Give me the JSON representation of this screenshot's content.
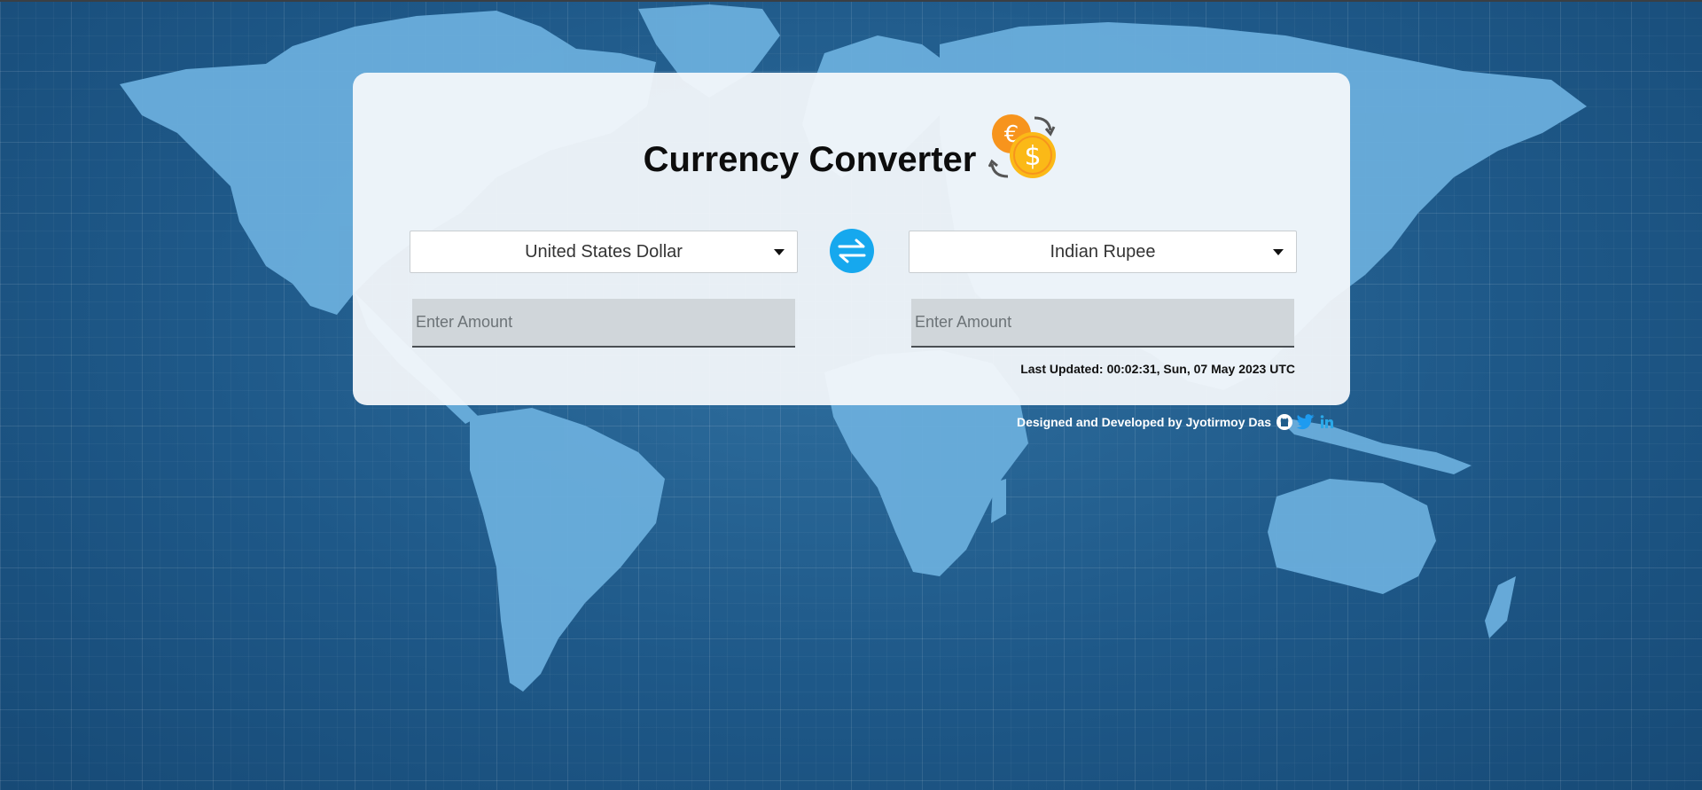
{
  "app": {
    "title": "Currency Converter",
    "logo_icon": "currency-exchange-icon"
  },
  "converter": {
    "from_currency": "United States Dollar",
    "to_currency": "Indian Rupee",
    "swap_icon": "swap-arrows-icon",
    "from_amount": {
      "value": "",
      "placeholder": "Enter Amount"
    },
    "to_amount": {
      "value": "",
      "placeholder": "Enter Amount"
    },
    "last_updated_label": "Last Updated:",
    "last_updated_value": "00:02:31, Sun, 07 May 2023 UTC"
  },
  "footer": {
    "credit": "Designed and Developed by Jyotirmoy Das",
    "links": [
      {
        "name": "github",
        "icon": "github-icon"
      },
      {
        "name": "twitter",
        "icon": "twitter-icon"
      },
      {
        "name": "linkedin",
        "icon": "linkedin-icon"
      }
    ]
  },
  "colors": {
    "accent": "#16a8ee",
    "background": "#1f5d8c",
    "map_land": "#6aaedc",
    "card": "#f4f8fb",
    "coin_orange": "#f7941d",
    "coin_yellow": "#fbb917"
  }
}
